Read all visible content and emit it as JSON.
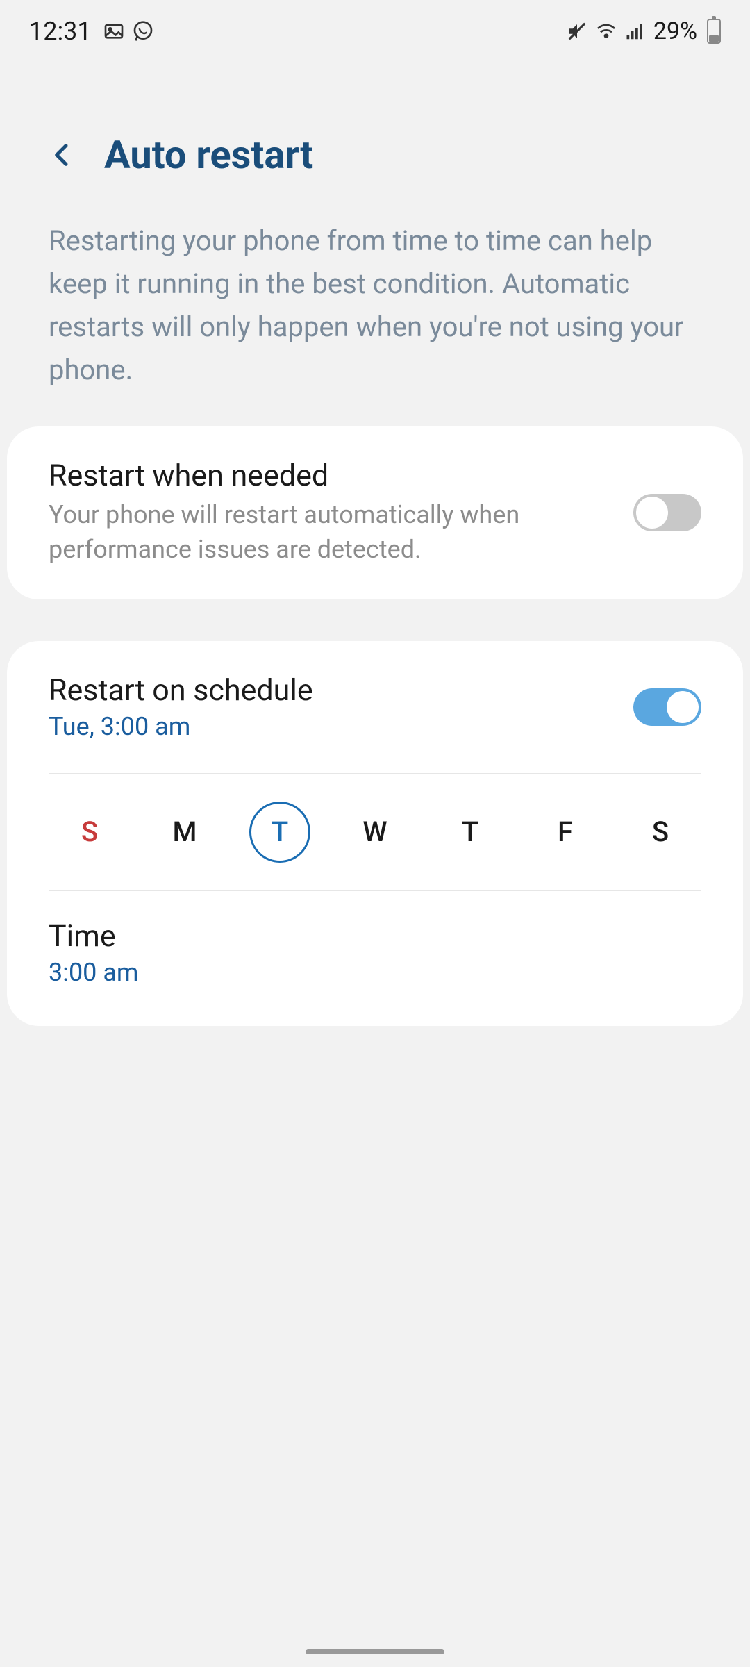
{
  "status": {
    "time": "12:31",
    "battery_text": "29%"
  },
  "header": {
    "title": "Auto restart"
  },
  "description": "Restarting your phone from time to time can help keep it running in the best condition. Automatic restarts will only happen when you're not using your phone.",
  "card1": {
    "title": "Restart when needed",
    "subtitle": "Your phone will restart automatically when performance issues are detected.",
    "toggle": false
  },
  "card2": {
    "schedule_title": "Restart on schedule",
    "schedule_subtitle": "Tue, 3:00 am",
    "toggle": true,
    "days": [
      {
        "label": "S",
        "selected": false,
        "sunday": true
      },
      {
        "label": "M",
        "selected": false,
        "sunday": false
      },
      {
        "label": "T",
        "selected": true,
        "sunday": false
      },
      {
        "label": "W",
        "selected": false,
        "sunday": false
      },
      {
        "label": "T",
        "selected": false,
        "sunday": false
      },
      {
        "label": "F",
        "selected": false,
        "sunday": false
      },
      {
        "label": "S",
        "selected": false,
        "sunday": false
      }
    ],
    "time_label": "Time",
    "time_value": "3:00 am"
  }
}
